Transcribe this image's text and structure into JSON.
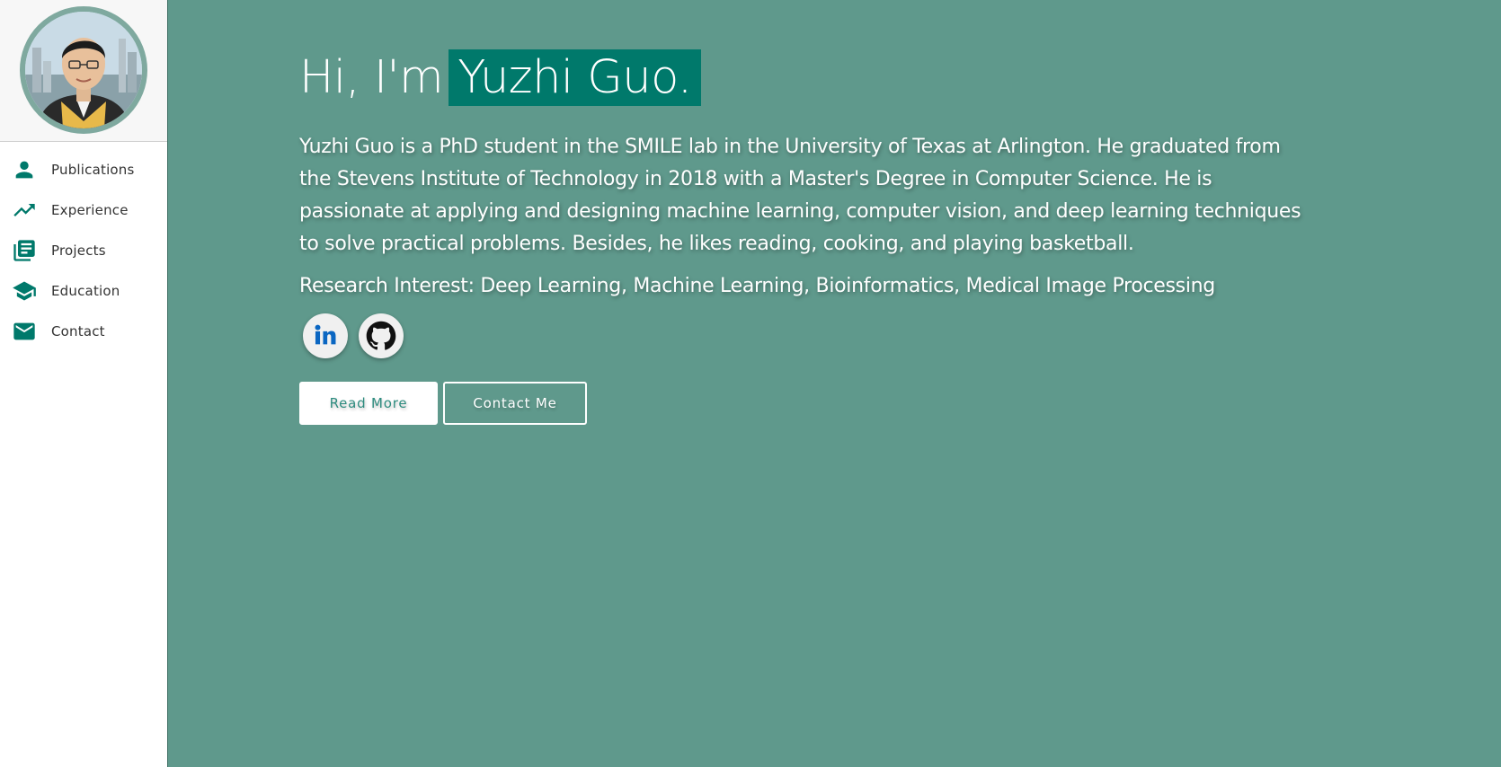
{
  "sidebar": {
    "avatar_alt": "profile photo",
    "items": [
      {
        "label": "Publications",
        "icon": "person-icon"
      },
      {
        "label": "Experience",
        "icon": "trending-up-icon"
      },
      {
        "label": "Projects",
        "icon": "library-books-icon"
      },
      {
        "label": "Education",
        "icon": "school-icon"
      },
      {
        "label": "Contact",
        "icon": "mail-icon"
      }
    ]
  },
  "hero": {
    "greeting": "Hi, I'm",
    "name": "Yuzhi Guo.",
    "bio": "Yuzhi Guo is a PhD student in the SMILE lab in the University of Texas at Arlington. He graduated from the Stevens Institute of Technology in 2018 with a Master's Degree in Computer Science. He is passionate at applying and designing machine learning, computer vision, and deep learning techniques to solve practical problems. Besides, he likes reading, cooking, and playing basketball.",
    "interest": "Research Interest: Deep Learning, Machine Learning, Bioinformatics, Medical Image Processing",
    "socials": [
      {
        "name": "linkedin-icon"
      },
      {
        "name": "github-icon"
      }
    ],
    "buttons": {
      "read_more": "Read More",
      "contact_me": "Contact Me"
    }
  },
  "colors": {
    "background": "#5f998c",
    "accent": "#00796b",
    "sidebar": "#ffffff"
  }
}
